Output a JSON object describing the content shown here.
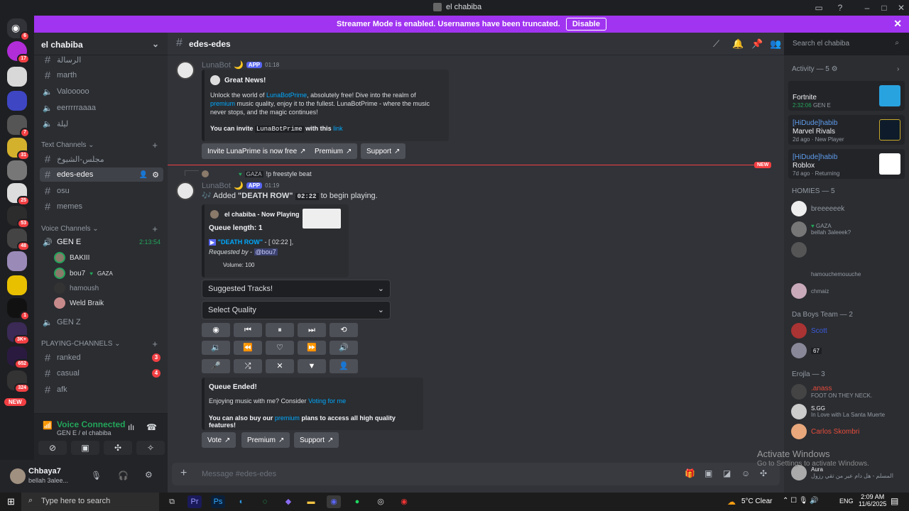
{
  "window": {
    "title": "el chabiba"
  },
  "banner": {
    "text": "Streamer Mode is enabled. Usernames have been truncated.",
    "disable": "Disable"
  },
  "guild_badges": [
    "6",
    "17",
    "7",
    "31",
    "25",
    "53",
    "48",
    "1",
    "3K+",
    "652",
    "324"
  ],
  "guild_new": "NEW",
  "server": {
    "name": "el chabiba"
  },
  "channels": {
    "top": [
      "الرسالة",
      "marth",
      "Valooooo",
      "eerrrrraaaa",
      "ليلة"
    ],
    "text_category": "Text Channels",
    "text": [
      "مجلس-الشيوخ",
      "edes-edes",
      "osu",
      "memes"
    ],
    "voice_category": "Voice Channels",
    "voice_gene": "GEN E",
    "voice_timer": "2:13:54",
    "voice_users": [
      {
        "name": "BAKIII",
        "tag": ""
      },
      {
        "name": "bou7",
        "tag": "GAZA"
      },
      {
        "name": "hamoush",
        "tag": ""
      },
      {
        "name": "Weld Braik",
        "tag": ""
      }
    ],
    "voice_genz": "GEN Z",
    "play_category": "PLAYING-CHANNELS",
    "play": [
      {
        "name": "ranked",
        "badge": "3"
      },
      {
        "name": "casual",
        "badge": "4"
      },
      {
        "name": "afk",
        "badge": ""
      }
    ]
  },
  "voice": {
    "title": "Voice Connected",
    "sub": "GEN E / el chabiba"
  },
  "user": {
    "name": "Chbaya7",
    "status": "bellah 3alee..."
  },
  "header": {
    "channel": "edes-edes",
    "search_placeholder": "Search el chabiba"
  },
  "messages": {
    "m1": {
      "user": "LunaBot",
      "app": "APP",
      "time": "01:18",
      "embed_title": "Great News!",
      "line1_a": "Unlock the world of ",
      "line1_link": "LunaBotPrime",
      "line1_b": ", absolutely free! Dive into the realm of",
      "line2_link": "premium",
      "line2_b": " music quality, enjoy it to the fullest. LunaBotPrime - where the music",
      "line3": "never stops, and the magic continues!",
      "invite_a": "You can invite ",
      "invite_code": "LunaBotPrime",
      "invite_b": " with this ",
      "invite_link": "link",
      "btn_invite": "Invite LunaPrime is now free",
      "btn_premium": "Premium",
      "btn_support": "Support"
    },
    "new_label": "NEW",
    "reply": {
      "tag": "GAZA",
      "text": "!p freestyle beat"
    },
    "m2": {
      "user": "LunaBot",
      "app": "APP",
      "time": "01:19",
      "added_a": "Added ",
      "added_song": "\"DEATH ROW\"",
      "added_dur": "02:22",
      "added_b": " to begin playing.",
      "np_title": "el chabiba - Now Playing",
      "queue": "Queue length: 1",
      "song_link": "\"DEATH ROW\"",
      "song_dur": " - [ 02:22 ],",
      "req_a": "Requested by - ",
      "req_user": "@bou7",
      "volume": "Volume: 100",
      "suggested": "Suggested Tracks!",
      "quality": "Select Quality",
      "ended_title": "Queue Ended!",
      "ended_line1_a": "Enjoying music with me? Consider ",
      "ended_line1_link": "Voting for me",
      "ended_line2_a": "You can also buy our ",
      "ended_line2_link": "premium",
      "ended_line2_b": " plans to access all high quality features!",
      "btn_vote": "Vote",
      "btn_premium": "Premium",
      "btn_support": "Support"
    }
  },
  "input_placeholder": "Message #edes-edes",
  "members": {
    "activity_header": "Activity — 5",
    "activities": [
      {
        "title": "Fortnite",
        "detail": "2:32:06",
        "channel": "GEN E"
      },
      {
        "user": "[HiDude]habib",
        "title": "Marvel Rivals",
        "detail": "2d ago",
        "note": "New Player"
      },
      {
        "user": "[HiDude]habib",
        "title": "Roblox",
        "detail": "7d ago",
        "note": "Returning"
      }
    ],
    "homies_header": "HOMIES — 5",
    "homies": [
      "breeeeeek",
      "GAZA",
      "bellah 3aleeek?",
      "",
      "hamouchemouuche",
      "chmaiz"
    ],
    "daboys_header": "Da Boys Team — 2",
    "daboys": [
      "Scott",
      "67"
    ],
    "erojla_header": "Erojla — 3",
    "erojla": [
      {
        "name": ".anass",
        "status": "FOOT ON THEY NECK."
      },
      {
        "name": "S.GG",
        "status": "In Love with La Santa Muerte"
      },
      {
        "name": "Carlos Skombri",
        "status": ""
      }
    ],
    "aura": "Aura",
    "last_status": "المسلم - هل دام عير من تقي رزول"
  },
  "watermark": {
    "title": "Activate Windows",
    "sub": "Go to Settings to activate Windows."
  },
  "taskbar": {
    "search": "Type here to search",
    "weather": "5°C  Clear",
    "lang": "ENG",
    "time": "2:09 AM",
    "date": "11/6/2025"
  }
}
